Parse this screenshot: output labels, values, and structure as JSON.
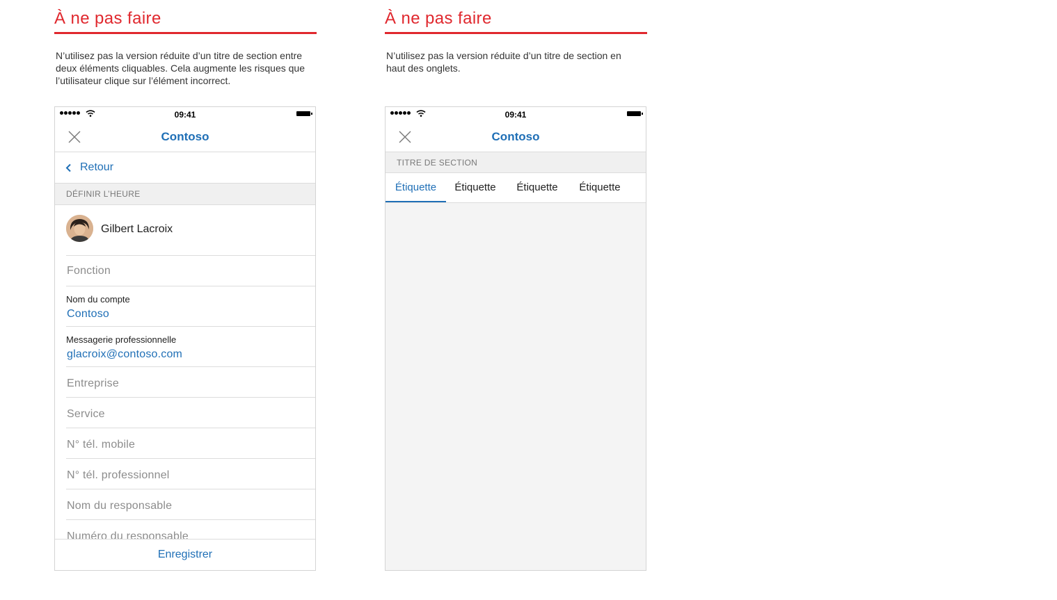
{
  "left": {
    "heading": "À ne pas faire",
    "description": "N’utilisez pas la version réduite d’un titre de section entre deux éléments cliquables. Cela augmente les risques que l’utilisateur clique sur l’élément incorrect.",
    "phone": {
      "status_time": "09:41",
      "nav_title": "Contoso",
      "back_label": "Retour",
      "section_title": "DÉFINIR L’HEURE",
      "contact_name": "Gilbert Lacroix",
      "fields": {
        "fonction": "Fonction",
        "account_label": "Nom du compte",
        "account_value": "Contoso",
        "email_label": "Messagerie professionnelle",
        "email_value": "glacroix@contoso.com",
        "entreprise": "Entreprise",
        "service": "Service",
        "mobile": "N° tél. mobile",
        "work_phone": "N° tél. professionnel",
        "manager": "Nom du responsable",
        "manager_number": "Numéro du responsable"
      },
      "save_label": "Enregistrer"
    }
  },
  "right": {
    "heading": "À ne pas faire",
    "description": "N’utilisez pas la version réduite d’un titre de section en haut des onglets.",
    "phone": {
      "status_time": "09:41",
      "nav_title": "Contoso",
      "section_title": "TITRE DE SECTION",
      "tabs": [
        {
          "label": "Étiquette",
          "active": true
        },
        {
          "label": "Étiquette",
          "active": false
        },
        {
          "label": "Étiquette",
          "active": false
        },
        {
          "label": "Étiquette",
          "active": false
        }
      ]
    }
  },
  "colors": {
    "warning_red": "#e0282e",
    "accent_blue": "#1f6fb6",
    "placeholder_gray": "#8c8c8c",
    "section_bg": "#f0f0f0"
  },
  "icons": [
    "close-icon",
    "chevron-left-icon",
    "wifi-icon",
    "battery-icon",
    "signal-icon"
  ]
}
